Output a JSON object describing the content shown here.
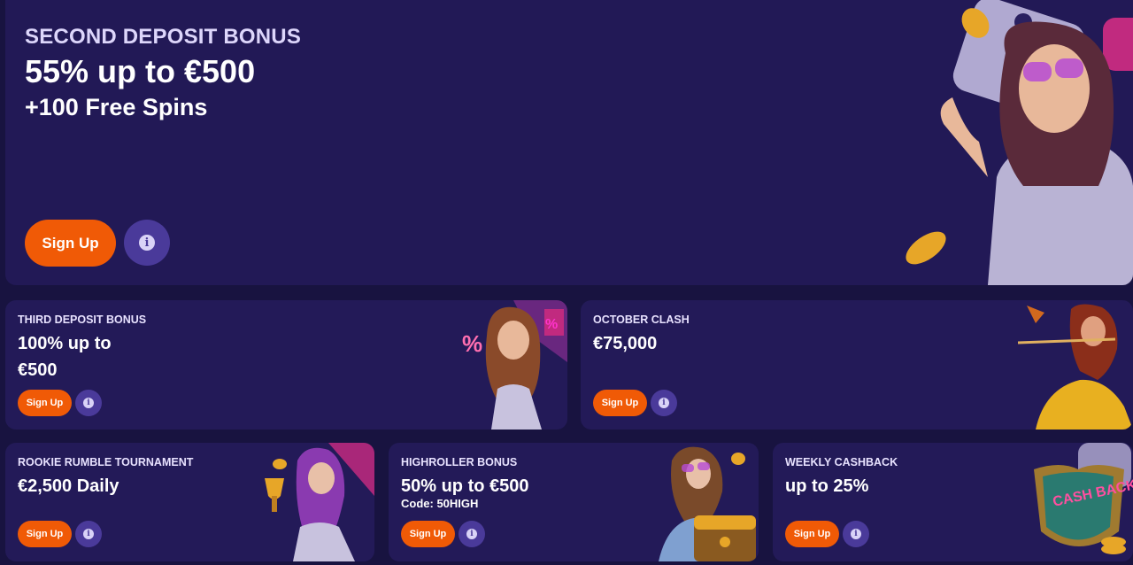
{
  "hero": {
    "eyebrow": "SECOND DEPOSIT BONUS",
    "title": "55% up to €500",
    "subtitle": "+100 Free Spins",
    "signup_label": "Sign Up",
    "info_icon": "info-icon"
  },
  "promos": [
    {
      "eyebrow": "THIRD DEPOSIT BONUS",
      "title_line1": "100% up to",
      "title_line2": "€500",
      "signup_label": "Sign Up"
    },
    {
      "eyebrow": "OCTOBER CLASH",
      "title": "€75,000",
      "signup_label": "Sign Up"
    },
    {
      "eyebrow": "ROOKIE RUMBLE TOURNAMENT",
      "title": "€2,500 Daily",
      "signup_label": "Sign Up"
    },
    {
      "eyebrow": "HIGHROLLER BONUS",
      "title": "50% up to €500",
      "code": "Code: 50HIGH",
      "signup_label": "Sign Up"
    },
    {
      "eyebrow": "WEEKLY CASHBACK",
      "title": "up to 25%",
      "signup_label": "Sign Up",
      "art_text": "CASH BACK"
    }
  ],
  "colors": {
    "background": "#181340",
    "card": "#231a58",
    "accent_orange": "#f05a06",
    "info_button": "#4a3a9a"
  }
}
